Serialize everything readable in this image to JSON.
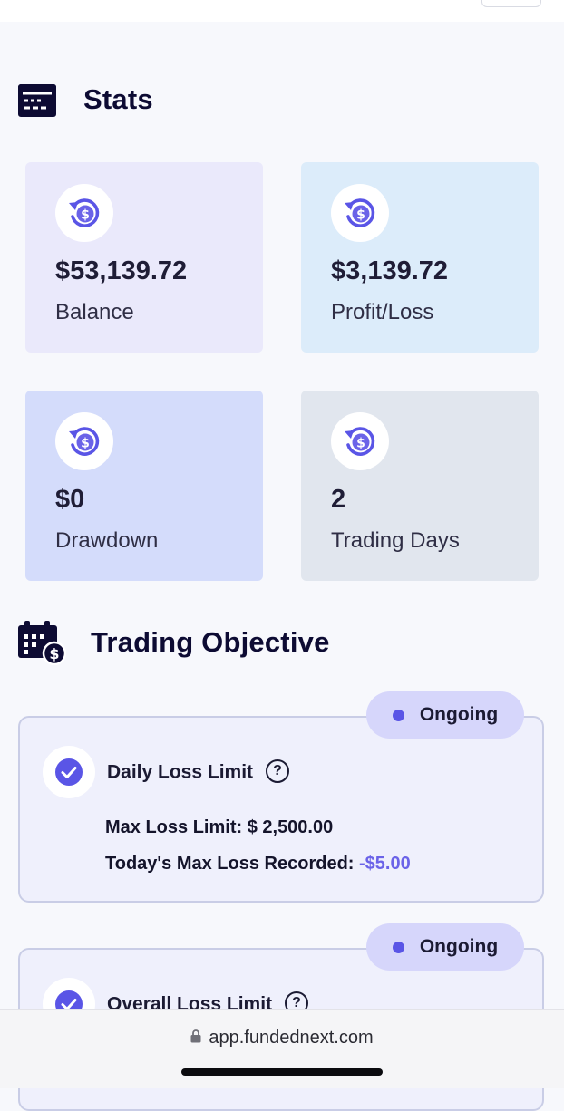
{
  "stats_section": {
    "title": "Stats",
    "cards": [
      {
        "value": "$53,139.72",
        "label": "Balance",
        "bg": "#eae9fb"
      },
      {
        "value": "$3,139.72",
        "label": "Profit/Loss",
        "bg": "#dcecfa"
      },
      {
        "value": "$0",
        "label": "Drawdown",
        "bg": "#d4dcfb"
      },
      {
        "value": "2",
        "label": "Trading Days",
        "bg": "#e1e6ee"
      }
    ]
  },
  "objective_section": {
    "title": "Trading Objective",
    "items": [
      {
        "status": "Ongoing",
        "title": "Daily Loss Limit",
        "help_glyph": "?",
        "max_loss_label": "Max Loss Limit:",
        "max_loss_value": "$ 2,500.00",
        "recorded_label": "Today's Max Loss Recorded:",
        "recorded_value": "-$5.00"
      },
      {
        "status": "Ongoing",
        "title": "Overall Loss Limit",
        "help_glyph": "?"
      }
    ]
  },
  "browser": {
    "url": "app.fundednext.com"
  },
  "colors": {
    "accent": "#5a55e6",
    "navy": "#0d0b33"
  }
}
